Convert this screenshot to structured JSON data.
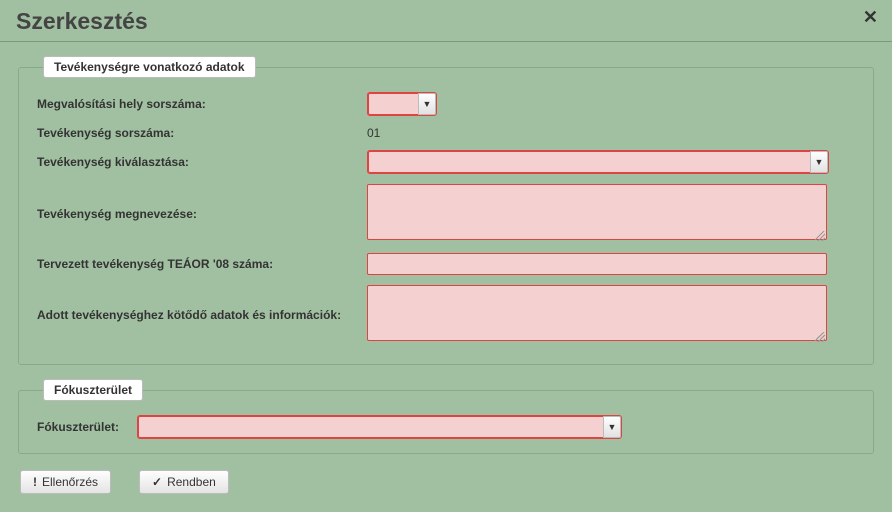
{
  "dialog": {
    "title": "Szerkesztés"
  },
  "fieldset1": {
    "legend": "Tevékenységre vonatkozó adatok",
    "labels": {
      "megvalositasi": "Megvalósítási hely sorszáma:",
      "tev_sorszam": "Tevékenység sorszáma:",
      "tev_kivalaszt": "Tevékenység kiválasztása:",
      "tev_megnev": "Tevékenység megnevezése:",
      "teaor": "Tervezett tevékenység TEÁOR '08 száma:",
      "adott": "Adott tevékenységhez kötődő adatok és információk:"
    },
    "values": {
      "tev_sorszam": "01",
      "megvalositasi": "",
      "tev_kivalaszt": "",
      "tev_megnev": "",
      "teaor": "",
      "adott": ""
    }
  },
  "fieldset2": {
    "legend": "Fókuszterület",
    "label": "Fókuszterület:",
    "value": ""
  },
  "buttons": {
    "check": "Ellenőrzés",
    "ok": "Rendben"
  },
  "icons": {
    "exclaim": "!",
    "check": "✓",
    "dropdown": "▼",
    "close": "✕"
  }
}
